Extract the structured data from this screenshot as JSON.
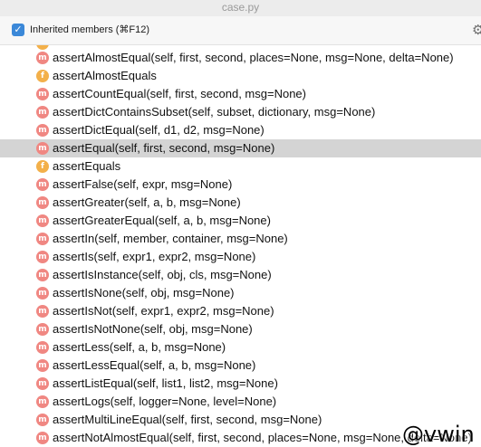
{
  "window": {
    "title": "case.py"
  },
  "header": {
    "checkbox_mark": "✓",
    "label": "Inherited members (⌘F12)",
    "gear_glyph": "⚙"
  },
  "members": [
    {
      "kind": "m",
      "text": "assertAlmostEqual(self, first, second, places=None, msg=None, delta=None)"
    },
    {
      "kind": "f",
      "text": "assertAlmostEquals"
    },
    {
      "kind": "m",
      "text": "assertCountEqual(self, first, second, msg=None)"
    },
    {
      "kind": "m",
      "text": "assertDictContainsSubset(self, subset, dictionary, msg=None)"
    },
    {
      "kind": "m",
      "text": "assertDictEqual(self, d1, d2, msg=None)"
    },
    {
      "kind": "m",
      "text": "assertEqual(self, first, second, msg=None)",
      "selected": true
    },
    {
      "kind": "f",
      "text": "assertEquals"
    },
    {
      "kind": "m",
      "text": "assertFalse(self, expr, msg=None)"
    },
    {
      "kind": "m",
      "text": "assertGreater(self, a, b, msg=None)"
    },
    {
      "kind": "m",
      "text": "assertGreaterEqual(self, a, b, msg=None)"
    },
    {
      "kind": "m",
      "text": "assertIn(self, member, container, msg=None)"
    },
    {
      "kind": "m",
      "text": "assertIs(self, expr1, expr2, msg=None)"
    },
    {
      "kind": "m",
      "text": "assertIsInstance(self, obj, cls, msg=None)"
    },
    {
      "kind": "m",
      "text": "assertIsNone(self, obj, msg=None)"
    },
    {
      "kind": "m",
      "text": "assertIsNot(self, expr1, expr2, msg=None)"
    },
    {
      "kind": "m",
      "text": "assertIsNotNone(self, obj, msg=None)"
    },
    {
      "kind": "m",
      "text": "assertLess(self, a, b, msg=None)"
    },
    {
      "kind": "m",
      "text": "assertLessEqual(self, a, b, msg=None)"
    },
    {
      "kind": "m",
      "text": "assertListEqual(self, list1, list2, msg=None)"
    },
    {
      "kind": "m",
      "text": "assertLogs(self, logger=None, level=None)"
    },
    {
      "kind": "m",
      "text": "assertMultiLineEqual(self, first, second, msg=None)"
    },
    {
      "kind": "m",
      "text": "assertNotAlmostEqual(self, first, second, places=None, msg=None, delta=None)"
    }
  ],
  "watermark": "@vwin"
}
